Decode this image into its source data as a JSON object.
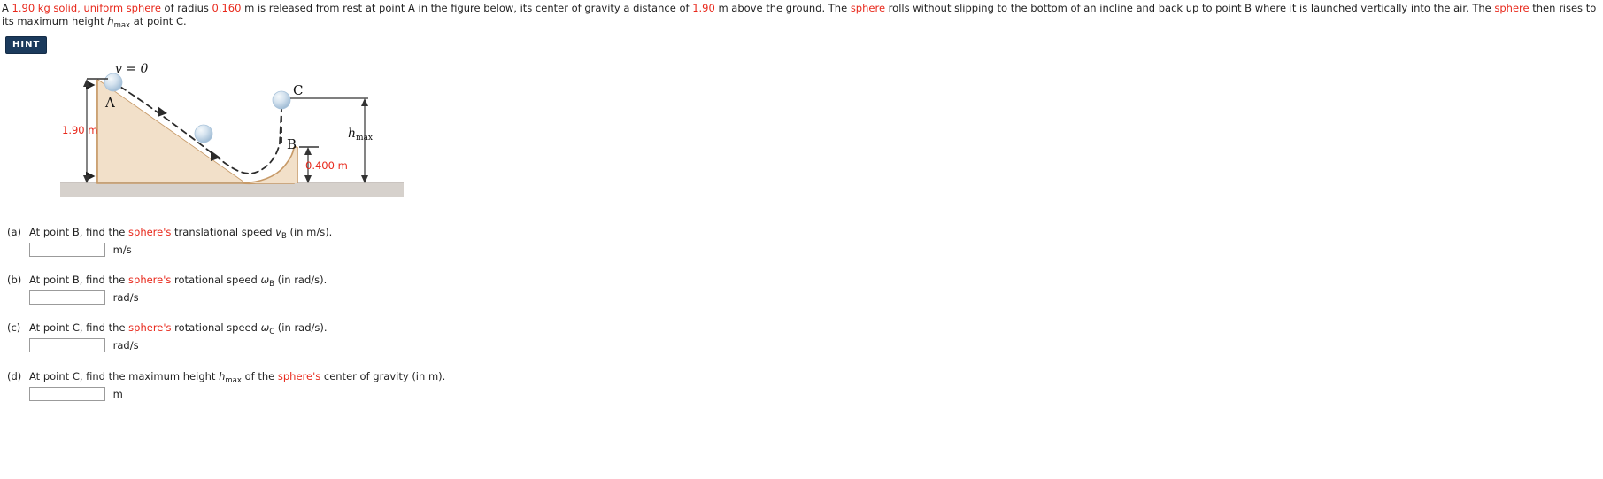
{
  "problem": {
    "line1_a": "A ",
    "mass": "1.90",
    "line1_b": " kg ",
    "solid_uniform_sphere": "solid, uniform sphere",
    "line1_c": " of radius ",
    "radius": "0.160",
    "line1_d": " m is released from rest at point A in the figure below, its center of gravity a distance of ",
    "height_A": "1.90",
    "line1_e": " m above the ground. The ",
    "sphere_word_1": "sphere",
    "line1_f": " rolls without slipping to the bottom of an incline and back up to point B where it is launched vertically into the air. The ",
    "sphere_word_2": "sphere",
    "line1_g": " then rises to its maximum height ",
    "hmax_symbol": "h",
    "hmax_sub": "max",
    "line1_h": " at point C."
  },
  "hint": {
    "label": "HINT"
  },
  "figure": {
    "label_v0": "v = 0",
    "label_A": "A",
    "label_B": "B",
    "label_C": "C",
    "label_hmax": "h",
    "label_hmax_sub": "max",
    "dim_height": "1.90 m",
    "dim_launch": "0.400 m",
    "colors": {
      "incline_fill": "#f2e0c9",
      "incline_edge": "#c79a68",
      "ground": "#d6d1cc",
      "sphere": "#b9cfe4",
      "dimension_text": "#e8291c"
    }
  },
  "parts": [
    {
      "tag": "(a)",
      "text_before": "At point B, find the ",
      "highlight": "sphere's",
      "text_after": " translational speed ",
      "symbol": "v",
      "symbol_sub": "B",
      "text_end": " (in m/s).",
      "value": "",
      "placeholder": "",
      "unit": "m/s"
    },
    {
      "tag": "(b)",
      "text_before": "At point B, find the ",
      "highlight": "sphere's",
      "text_after": " rotational speed ",
      "symbol": "ω",
      "symbol_sub": "B",
      "text_end": " (in rad/s).",
      "value": "",
      "placeholder": "",
      "unit": "rad/s"
    },
    {
      "tag": "(c)",
      "text_before": "At point C, find the ",
      "highlight": "sphere's",
      "text_after": " rotational speed ",
      "symbol": "ω",
      "symbol_sub": "C",
      "text_end": " (in rad/s).",
      "value": "",
      "placeholder": "",
      "unit": "rad/s"
    },
    {
      "tag": "(d)",
      "text_before": "At point C, find the maximum height ",
      "highlight2": "h",
      "highlight2_sub": "max",
      "text_after": " of the ",
      "highlight": "sphere's",
      "text_end": " center of gravity (in m).",
      "value": "",
      "placeholder": "",
      "unit": "m"
    }
  ]
}
